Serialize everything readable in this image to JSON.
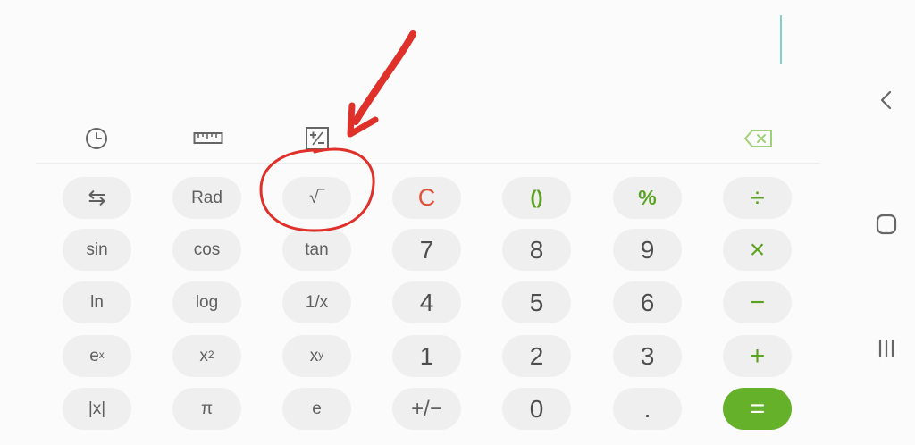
{
  "display": {
    "expression": ""
  },
  "toolbar": {
    "history_icon": "clock-icon",
    "converter_icon": "ruler-icon",
    "scientific_toggle_icon": "plus-minus-icon",
    "backspace_icon": "backspace-icon",
    "backspace_color": "#6ab04c"
  },
  "keys": {
    "swap": "⇆",
    "rad": "Rad",
    "sqrt": "√‾",
    "clear": "C",
    "parens": "()",
    "percent": "%",
    "divide": "÷",
    "sin": "sin",
    "cos": "cos",
    "tan": "tan",
    "n7": "7",
    "n8": "8",
    "n9": "9",
    "multiply": "×",
    "ln": "ln",
    "log": "log",
    "reciprocal": "1/x",
    "n4": "4",
    "n5": "5",
    "n6": "6",
    "minus": "−",
    "ex_base": "e",
    "ex_exp": "x",
    "x2_base": "x",
    "x2_exp": "2",
    "xy_base": "x",
    "xy_exp": "y",
    "n1": "1",
    "n2": "2",
    "n3": "3",
    "plus": "+",
    "abs": "|x|",
    "pi": "π",
    "e": "e",
    "sign": "+/−",
    "n0": "0",
    "dot": ".",
    "equals": "="
  },
  "navbar": {
    "back_icon": "chevron-left-icon",
    "home_icon": "rounded-square-icon",
    "recents_icon": "three-bars-icon"
  },
  "colors": {
    "accent_green": "#65b12a",
    "clear_red": "#e0533a",
    "cursor_teal": "#7fd3c7",
    "annotation_red": "#e0302a"
  }
}
